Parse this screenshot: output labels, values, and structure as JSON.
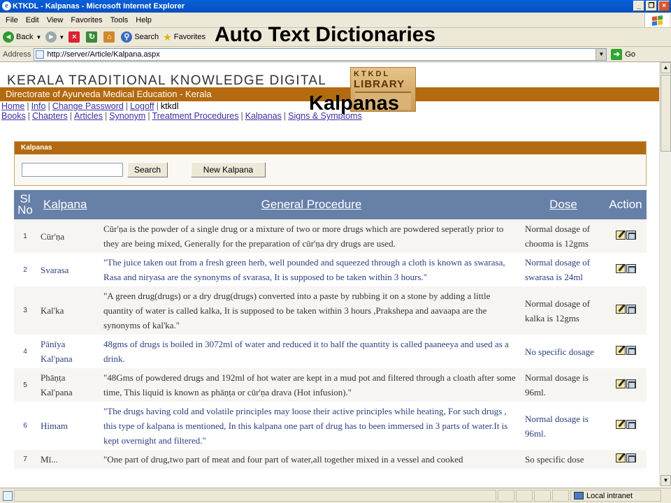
{
  "window": {
    "title": "KTKDL - Kalpanas - Microsoft Internet Explorer"
  },
  "menu": [
    "File",
    "Edit",
    "View",
    "Favorites",
    "Tools",
    "Help"
  ],
  "toolbar": {
    "back": "Back",
    "search": "Search",
    "favorites": "Favorites"
  },
  "overlay_title": "Auto Text Dictionaries",
  "address": {
    "label": "Address",
    "url": "http://server/Article/Kalpana.aspx",
    "go": "Go"
  },
  "site": {
    "title": "KERALA TRADITIONAL KNOWLEDGE DIGITAL",
    "subtitle": "Directorate of Ayurveda Medical Education - Kerala",
    "logo_line1": "KTKDL",
    "logo_line2": "LIBRARY"
  },
  "nav1": {
    "home": "Home",
    "info": "Info",
    "change_password": "Change Password",
    "logoff": "Logoff",
    "user": "ktkdl"
  },
  "nav2": [
    "Books",
    "Chapters",
    "Articles",
    "Synonym",
    "Treatment Procedures",
    "Kalpanas",
    "Signs & Symptoms"
  ],
  "panel": {
    "heading": "Kalpanas",
    "search_value": "",
    "search_button": "Search",
    "new_button": "New Kalpana"
  },
  "overlay_kalpanas": "Kalpanas",
  "table": {
    "headers": {
      "sl": "Sl No",
      "kalpana": "Kalpana",
      "procedure": "General Procedure",
      "dose": "Dose",
      "action": "Action"
    },
    "rows": [
      {
        "no": "1",
        "kalpana": "Cūr'ṇa",
        "procedure": "Cūr'ṇa is the powder of a single drug or a mixture of two or more drugs which are powdered seperatly prior to they are being mixed, Generally for the preparation of cūr'ṇa dry drugs are used.",
        "dose": "Normal dosage of chooma is 12gms"
      },
      {
        "no": "2",
        "kalpana": "Svarasa",
        "procedure": "\"The juice taken out from a fresh green herb, well pounded and squeezed through a cloth is known as swarasa, Rasa and niryasa are the synonyms of svarasa, It is supposed to be taken within 3 hours.\"",
        "dose": "Normal dosage of swarasa is 24ml"
      },
      {
        "no": "3",
        "kalpana": "Kal'ka",
        "procedure": "\"A green drug(drugs) or a dry drug(drugs) converted into a paste by rubbing it on a stone by adding a little quantity of water is called kalka, It is supposed to be taken within 3 hours ,Prakshepa and aavaapa are the synonyms of kal'ka.\"",
        "dose": "Normal dosage of kalka is 12gms"
      },
      {
        "no": "4",
        "kalpana": "Pānīya Kal'pana",
        "procedure": "48gms of drugs is boiled in 3072ml of water and reduced it to half the quantity is called paaneeya and used as a drink.",
        "dose": "No specific dosage"
      },
      {
        "no": "5",
        "kalpana": "Phāṇṭa Kal'pana",
        "procedure": "\"48Gms of powdered drugs and 192ml of hot water are kept in a mud pot and filtered through a cloath after some time, This liquid is known as phāṇṭa or cūr'ṇa drava (Hot infusion).\"",
        "dose": "Normal dosage is 96ml."
      },
      {
        "no": "6",
        "kalpana": "Himam",
        "procedure": "\"The drugs having cold and volatile principles may loose their active principles while heating, For such drugs , this type of kalpana is mentioned, In this kalpana one part of drug has to been immersed in 3 parts of water.It is kept overnight and filtered.\"",
        "dose": "Normal dosage is 96ml."
      },
      {
        "no": "7",
        "kalpana": "Mī...",
        "procedure": "\"One part of drug,two part of meat and four part of water,all together mixed in a vessel and cooked",
        "dose": "So specific dose"
      }
    ]
  },
  "status": {
    "zone": "Local intranet"
  }
}
